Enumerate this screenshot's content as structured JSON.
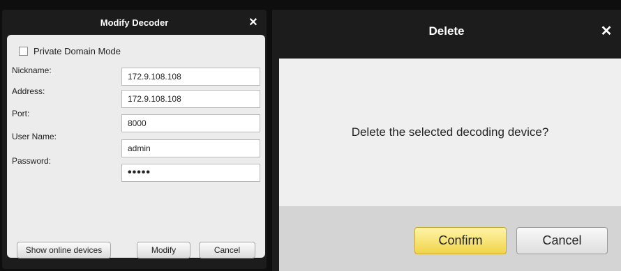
{
  "modify_dialog": {
    "title": "Modify Decoder",
    "close_glyph": "✕",
    "private_domain_label": "Private Domain Mode",
    "private_domain_checked": false,
    "fields": [
      {
        "label": "Nickname:",
        "value": "172.9.108.108"
      },
      {
        "label": "Address:",
        "value": "172.9.108.108"
      },
      {
        "label": "Port:",
        "value": "8000"
      },
      {
        "label": "User Name:",
        "value": "admin"
      },
      {
        "label": "Password:",
        "value": "•••••"
      }
    ],
    "buttons": {
      "show_online": "Show online devices",
      "modify": "Modify",
      "cancel": "Cancel"
    }
  },
  "delete_dialog": {
    "title": "Delete",
    "close_glyph": "✕",
    "message": "Delete the selected decoding device?",
    "buttons": {
      "confirm": "Confirm",
      "cancel": "Cancel"
    }
  },
  "colors": {
    "dialog_chrome": "#1c1c1c",
    "panel_bg": "#ececec",
    "confirm_accent": "#f0d44a"
  }
}
